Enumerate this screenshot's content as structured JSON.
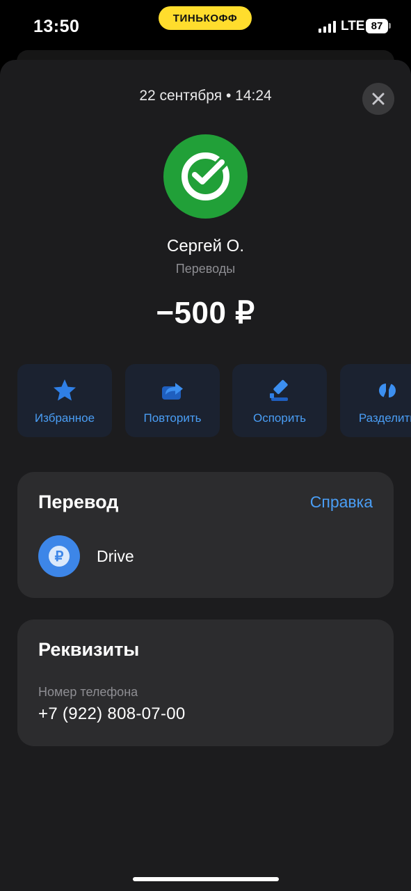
{
  "status_bar": {
    "time": "13:50",
    "bank_badge": "ТИНЬКОФФ",
    "network": "LTE",
    "battery": "87"
  },
  "transaction": {
    "date_time": "22 сентября • 14:24",
    "counterparty": "Сергей О.",
    "category": "Переводы",
    "amount": "−500 ₽"
  },
  "actions": [
    {
      "label": "Избранное",
      "icon": "star-icon"
    },
    {
      "label": "Повторить",
      "icon": "repeat-icon"
    },
    {
      "label": "Оспорить",
      "icon": "dispute-icon"
    },
    {
      "label": "Разделить",
      "icon": "split-icon"
    }
  ],
  "transfer_card": {
    "title": "Перевод",
    "help_link": "Справка",
    "item_label": "Drive",
    "item_icon_glyph": "₽"
  },
  "details_card": {
    "title": "Реквизиты",
    "phone_label": "Номер телефона",
    "phone_value": "+7 (922) 808-07-00"
  },
  "colors": {
    "accent": "#4a9ef5",
    "bank_yellow": "#ffdd2d",
    "sber_green": "#21a038",
    "sheet_bg": "#1c1c1e",
    "card_bg": "#2c2c2e"
  }
}
